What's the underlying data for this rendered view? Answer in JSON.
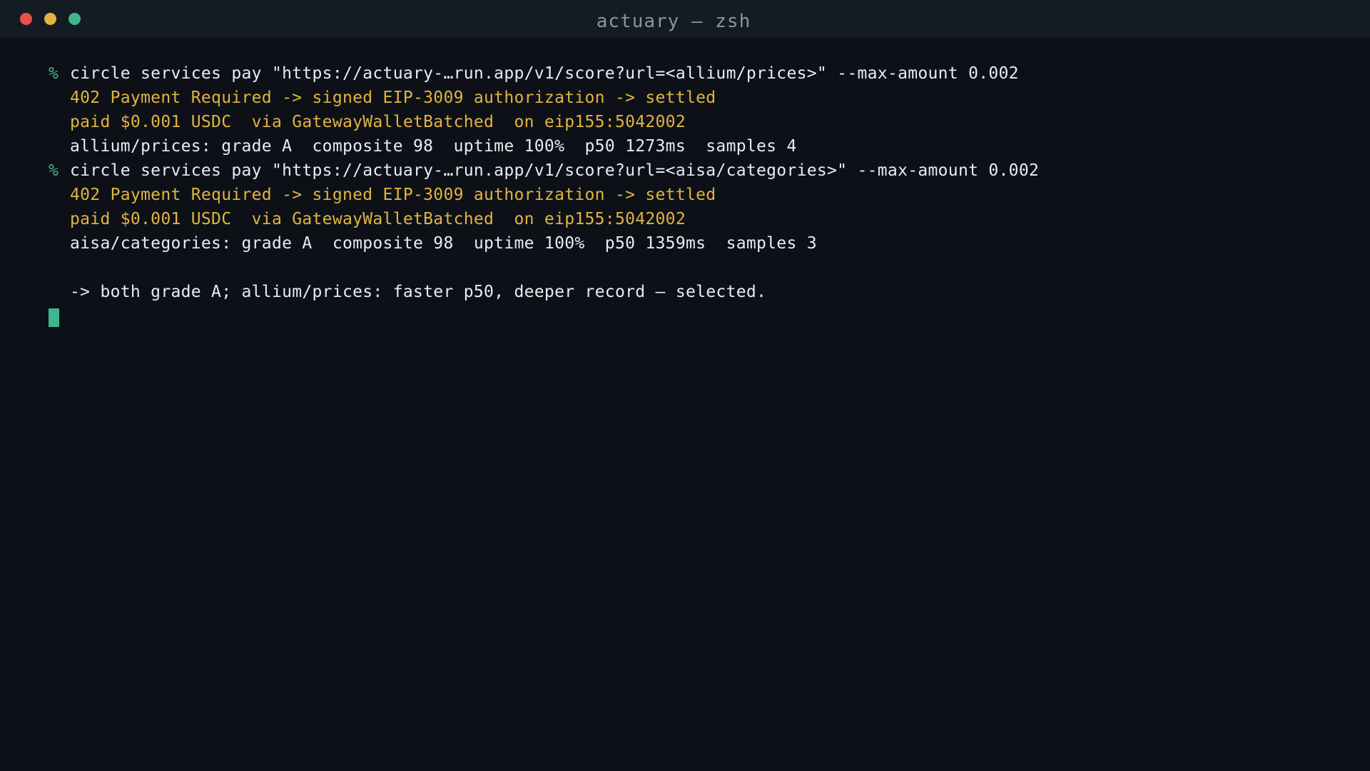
{
  "window": {
    "title": "actuary — zsh",
    "controls": {
      "close": "#e5534b",
      "minimize": "#e3b341",
      "maximize": "#3fb68b"
    }
  },
  "colors": {
    "background": "#0d1117",
    "titlebar": "#151b23",
    "prompt": "#3fb68b",
    "info": "#e3b341",
    "text": "#e6edf3",
    "cursor": "#3fb68b"
  },
  "terminal": {
    "prompt_symbol": "%",
    "blocks": [
      {
        "command": "circle services pay \"https://actuary-…run.app/v1/score?url=<allium/prices>\" --max-amount 0.002",
        "payment_status": "402 Payment Required -> signed EIP-3009 authorization -> settled",
        "payment_detail": "paid $0.001 USDC  via GatewayWalletBatched  on eip155:5042002",
        "result": "allium/prices: grade A  composite 98  uptime 100%  p50 1273ms  samples 4"
      },
      {
        "command": "circle services pay \"https://actuary-…run.app/v1/score?url=<aisa/categories>\" --max-amount 0.002",
        "payment_status": "402 Payment Required -> signed EIP-3009 authorization -> settled",
        "payment_detail": "paid $0.001 USDC  via GatewayWalletBatched  on eip155:5042002",
        "result": "aisa/categories: grade A  composite 98  uptime 100%  p50 1359ms  samples 3"
      }
    ],
    "summary": "-> both grade A; allium/prices: faster p50, deeper record — selected."
  }
}
